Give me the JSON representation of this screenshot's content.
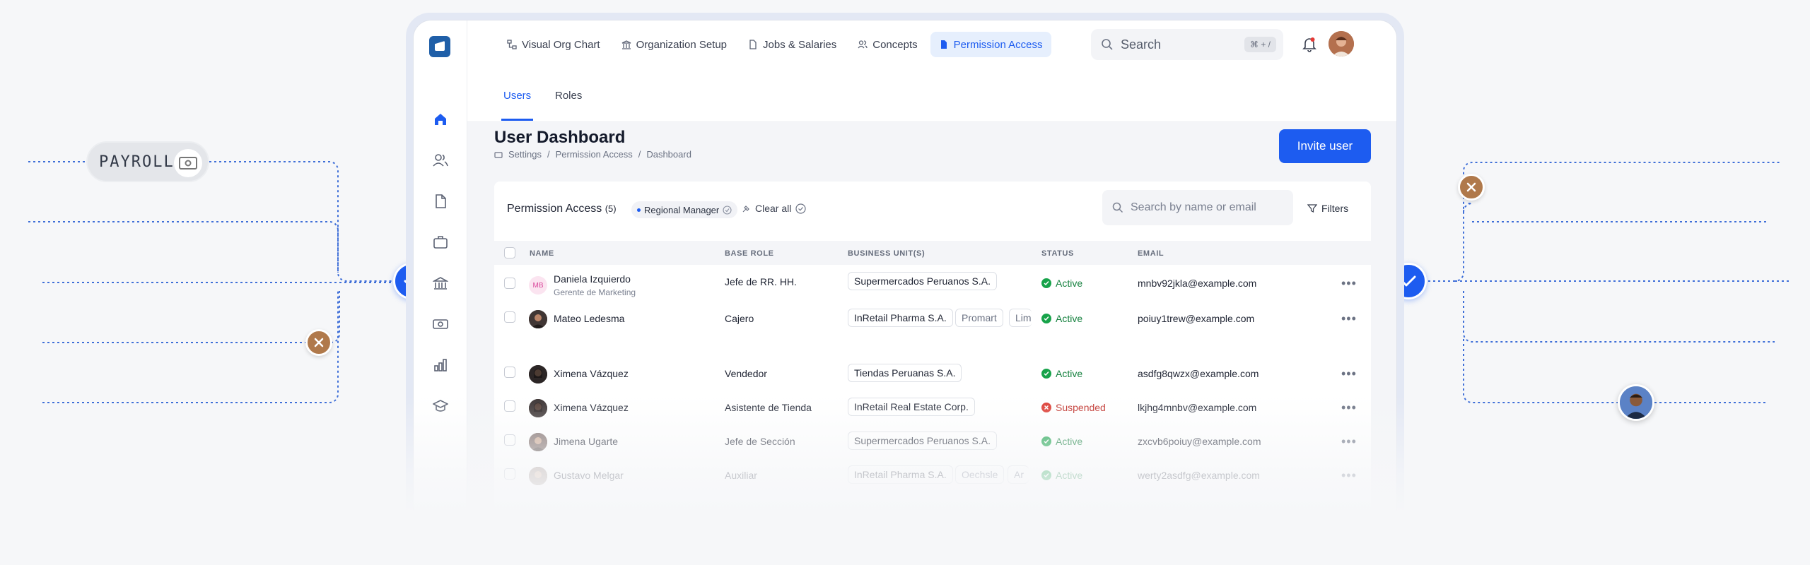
{
  "payroll": {
    "label": "PAYROLL"
  },
  "nav": {
    "items": [
      {
        "label": "Visual Org Chart",
        "icon": "org-chart-icon"
      },
      {
        "label": "Organization Setup",
        "icon": "building-icon"
      },
      {
        "label": "Jobs & Salaries",
        "icon": "document-icon"
      },
      {
        "label": "Concepts",
        "icon": "users-icon"
      },
      {
        "label": "Permission Access",
        "icon": "file-icon",
        "active": true
      }
    ],
    "search_placeholder": "Search",
    "search_shortcut": "⌘ + /"
  },
  "subtabs": [
    "Users",
    "Roles"
  ],
  "page": {
    "title": "User Dashboard",
    "breadcrumb": [
      "Settings",
      "Permission Access",
      "Dashboard"
    ],
    "invite_label": "Invite user"
  },
  "card": {
    "title": "Permission Access",
    "count": "(5)",
    "filter_chip": "Regional Manager",
    "clear_all": "Clear all",
    "search_placeholder": "Search by name or email",
    "filters_label": "Filters",
    "columns": [
      "NAME",
      "BASE ROLE",
      "BUSINESS UNIT(S)",
      "STATUS",
      "EMAIL"
    ]
  },
  "rows": [
    {
      "name": "Daniela Izquierdo",
      "subtitle": "Gerente de Marketing",
      "initials": "MB",
      "role": "Jefe de RR. HH.",
      "units": [
        "Supermercados Peruanos S.A."
      ],
      "status": "Active",
      "email": "mnbv92jkla@example.com"
    },
    {
      "name": "Mateo Ledesma",
      "role": "Cajero",
      "units": [
        "InRetail Pharma S.A.",
        "Promart",
        "Lima"
      ],
      "status": "Active",
      "email": "poiuy1trew@example.com"
    },
    {
      "name": "Ximena Vázquez",
      "role": "Vendedor",
      "units": [
        "Tiendas Peruanas S.A."
      ],
      "status": "Active",
      "email": "asdfg8qwzx@example.com"
    },
    {
      "name": "Ximena Vázquez",
      "role": "Asistente de Tienda",
      "units": [
        "InRetail Real Estate Corp."
      ],
      "status": "Suspended",
      "email": "lkjhg4mnbv@example.com"
    },
    {
      "name": "Jimena Ugarte",
      "role": "Jefe de Sección",
      "units": [
        "Supermercados Peruanos S.A."
      ],
      "status": "Active",
      "email": "zxcvb6poiuy@example.com"
    },
    {
      "name": "Gustavo Melgar",
      "role": "Auxiliar",
      "units": [
        "InRetail Pharma S.A.",
        "Oechsle",
        "Ar"
      ],
      "status": "Active",
      "email": "werty2asdfg@example.com"
    }
  ],
  "colors": {
    "accent": "#1d5cf0",
    "active": "#16813f",
    "suspended": "#c0302a",
    "x_node": "#b0794b"
  }
}
